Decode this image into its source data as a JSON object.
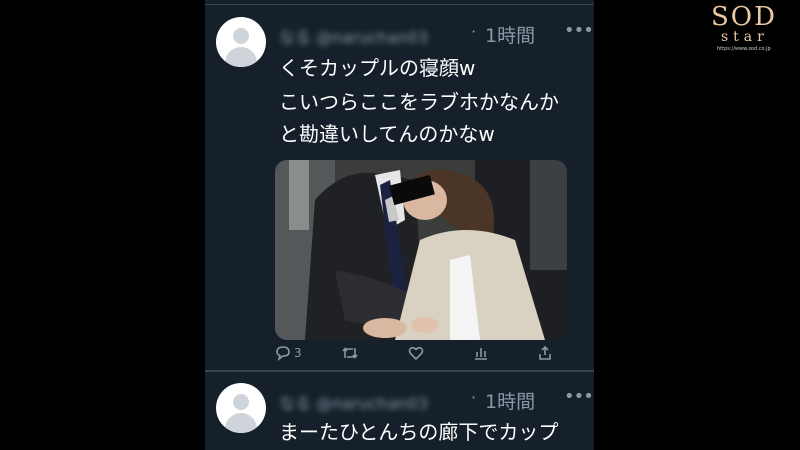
{
  "watermark": {
    "logo": "SOD",
    "sub": "star",
    "url": "https://www.sod.co.jp"
  },
  "tweets": [
    {
      "name": "なる @naruchan03",
      "time": "1時間",
      "more": "•••",
      "lines": [
        "くそカップルの寝顔w",
        "こいつらここをラブホかなんか",
        "と勘違いしてんのかなw"
      ],
      "has_photo": true,
      "actions": {
        "replies": "3",
        "retweets": "",
        "likes": ""
      }
    },
    {
      "name": "なる @naruchan03",
      "time": "1時間",
      "more": "•••",
      "lines": [
        "まーたひとんちの廊下でカップ"
      ]
    }
  ],
  "icons": [
    "reply-icon",
    "retweet-icon",
    "like-icon",
    "stats-icon",
    "share-icon",
    "avatar-placeholder-icon"
  ],
  "colors": {
    "background": "#15202b",
    "text": "#ffffff",
    "muted": "#8899a6",
    "accent": "#e9c9a3"
  }
}
